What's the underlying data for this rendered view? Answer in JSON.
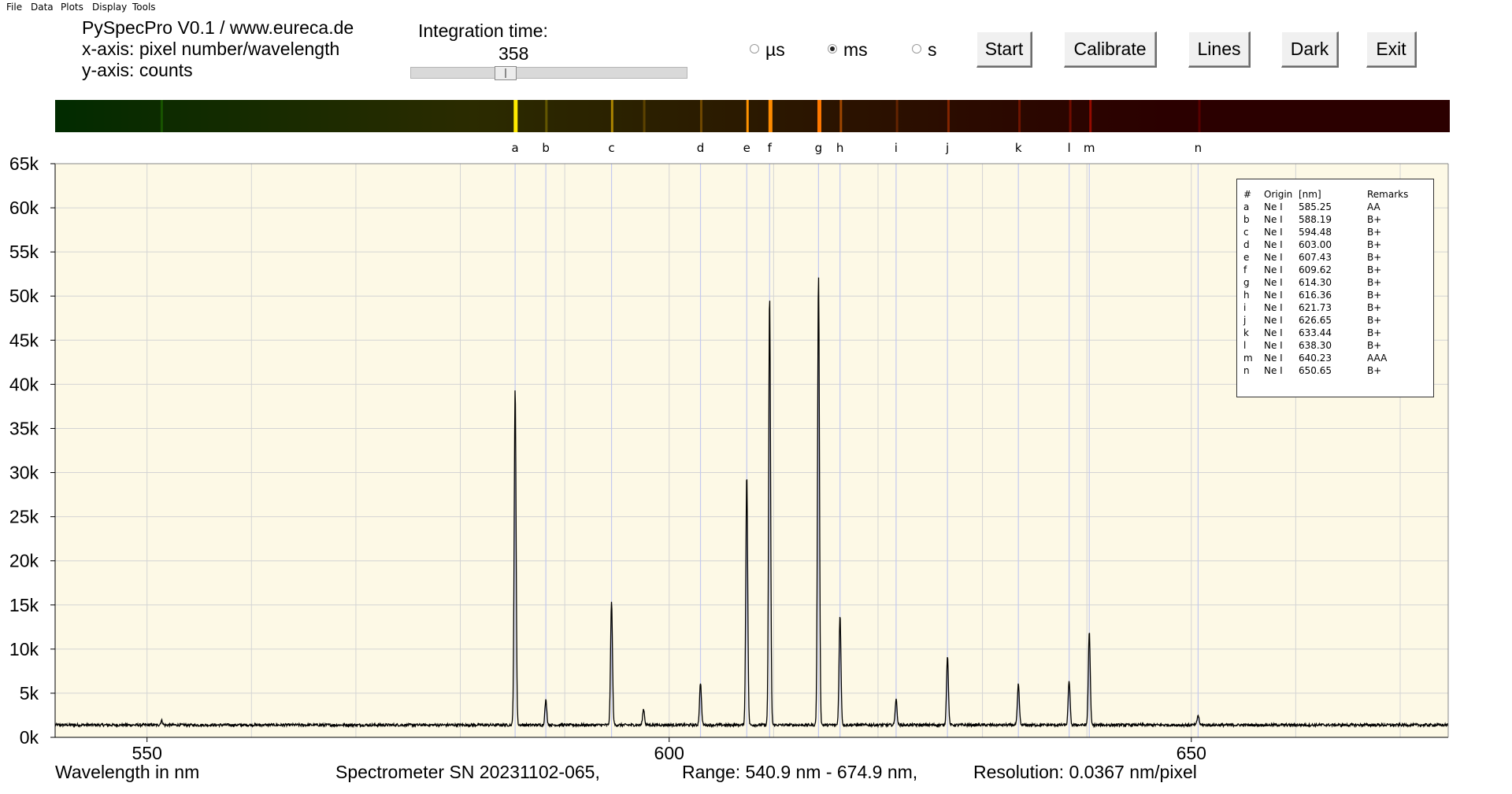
{
  "menu": [
    "File",
    "Data",
    "Plots",
    "Display",
    "Tools"
  ],
  "info": {
    "title": "PySpecPro V0.1 / www.eureca.de",
    "x_axis": "x-axis: pixel number/wavelength",
    "y_axis": "y-axis: counts"
  },
  "integration": {
    "label": "Integration time:",
    "value": "358",
    "slider_fraction": 0.33
  },
  "units": [
    {
      "label": "µs",
      "selected": false
    },
    {
      "label": "ms",
      "selected": true
    },
    {
      "label": "s",
      "selected": false
    }
  ],
  "buttons": {
    "start": "Start",
    "calibrate": "Calibrate",
    "lines": "Lines",
    "dark": "Dark",
    "exit": "Exit"
  },
  "legend": {
    "headers": [
      "#",
      "Origin",
      "[nm]",
      "Remarks"
    ],
    "rows": [
      [
        "a",
        "Ne I",
        "585.25",
        "AA"
      ],
      [
        "b",
        "Ne I",
        "588.19",
        "B+"
      ],
      [
        "c",
        "Ne I",
        "594.48",
        "B+"
      ],
      [
        "d",
        "Ne I",
        "603.00",
        "B+"
      ],
      [
        "e",
        "Ne I",
        "607.43",
        "B+"
      ],
      [
        "f",
        "Ne I",
        "609.62",
        "B+"
      ],
      [
        "g",
        "Ne I",
        "614.30",
        "B+"
      ],
      [
        "h",
        "Ne I",
        "616.36",
        "B+"
      ],
      [
        "i",
        "Ne I",
        "621.73",
        "B+"
      ],
      [
        "j",
        "Ne I",
        "626.65",
        "B+"
      ],
      [
        "k",
        "Ne I",
        "633.44",
        "B+"
      ],
      [
        "l",
        "Ne I",
        "638.30",
        "B+"
      ],
      [
        "m",
        "Ne I",
        "640.23",
        "AAA"
      ],
      [
        "n",
        "Ne I",
        "650.65",
        "B+"
      ]
    ]
  },
  "status": {
    "xlabel": "Wavelength in nm",
    "serial": "Spectrometer SN 20231102-065,",
    "range": "Range: 540.9 nm - 674.9 nm,",
    "resolution": "Resolution: 0.0367 nm/pixel"
  },
  "colors": {
    "plot_bg": "#fdf9e6",
    "grid": "#d4d4d4",
    "line_marker": "#c3c9ef",
    "trace": "#000000"
  },
  "chart_data": {
    "type": "line",
    "xlabel": "Wavelength in nm",
    "ylabel": "",
    "xlim": [
      541.2,
      674.6
    ],
    "ylim": [
      0,
      65000
    ],
    "x_ticks": [
      550,
      600,
      650
    ],
    "x_tick_labels": [
      "550",
      "600",
      "650"
    ],
    "y_ticks": [
      0,
      5000,
      10000,
      15000,
      20000,
      25000,
      30000,
      35000,
      40000,
      45000,
      50000,
      55000,
      60000,
      65000
    ],
    "y_tick_labels": [
      "0k",
      "5k",
      "10k",
      "15k",
      "20k",
      "25k",
      "30k",
      "35k",
      "40k",
      "45k",
      "50k",
      "55k",
      "60k",
      "65k"
    ],
    "grid": true,
    "baseline": 1400,
    "markers": [
      {
        "label": "a",
        "x": 585.25
      },
      {
        "label": "b",
        "x": 588.19
      },
      {
        "label": "c",
        "x": 594.48
      },
      {
        "label": "d",
        "x": 603.0
      },
      {
        "label": "e",
        "x": 607.43
      },
      {
        "label": "f",
        "x": 609.62
      },
      {
        "label": "g",
        "x": 614.3
      },
      {
        "label": "h",
        "x": 616.36
      },
      {
        "label": "i",
        "x": 621.73
      },
      {
        "label": "j",
        "x": 626.65
      },
      {
        "label": "k",
        "x": 633.44
      },
      {
        "label": "l",
        "x": 638.3
      },
      {
        "label": "m",
        "x": 640.23
      },
      {
        "label": "n",
        "x": 650.65
      }
    ],
    "peaks": [
      {
        "x": 551.4,
        "y": 1900
      },
      {
        "x": 585.25,
        "y": 39500
      },
      {
        "x": 588.19,
        "y": 4200
      },
      {
        "x": 594.48,
        "y": 15500
      },
      {
        "x": 597.55,
        "y": 3200
      },
      {
        "x": 603.0,
        "y": 6200
      },
      {
        "x": 607.43,
        "y": 29800
      },
      {
        "x": 609.62,
        "y": 50000
      },
      {
        "x": 614.3,
        "y": 52300
      },
      {
        "x": 616.36,
        "y": 13800
      },
      {
        "x": 621.73,
        "y": 4300
      },
      {
        "x": 626.65,
        "y": 9200
      },
      {
        "x": 633.44,
        "y": 6000
      },
      {
        "x": 638.3,
        "y": 6400
      },
      {
        "x": 640.23,
        "y": 12000
      },
      {
        "x": 650.65,
        "y": 2500
      }
    ]
  }
}
